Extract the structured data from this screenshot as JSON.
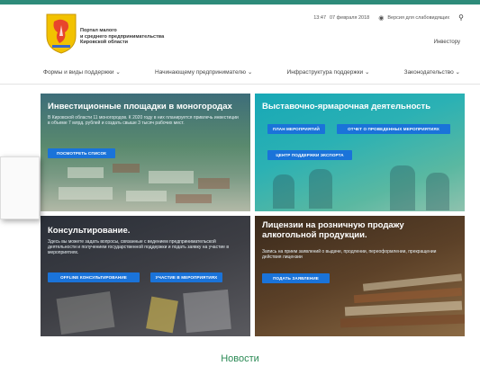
{
  "utility": {
    "time": "13:47",
    "date": "07 февраля 2018",
    "accessibility_label": "Версия для слабовидящих"
  },
  "org": {
    "name_line1": "Портал малого",
    "name_line2": "и среднего предпринимательства",
    "name_line3": "Кировской области"
  },
  "investor_link": "Инвестору",
  "nav": {
    "items": [
      {
        "label": "Формы и виды поддержки ⌄"
      },
      {
        "label": "Начинающему предпринимателю ⌄"
      },
      {
        "label": "Инфраструктура поддержки ⌄"
      },
      {
        "label": "Законодательство ⌄"
      }
    ]
  },
  "tiles": [
    {
      "title": "Инвестиционные площадки в моногородах",
      "desc": "В Кировской области 11 моногородов. К 2020 году в них планируется привлечь инвестиции в объеме 7 млрд. рублей и создать свыше 3 тысяч рабочих мест.",
      "buttons": [
        "ПОСМОТРЕТЬ СПИСОК"
      ]
    },
    {
      "title": "Выставочно-ярмарочная деятельность",
      "desc": "",
      "buttons": [
        "ПЛАН МЕРОПРИЯТИЙ",
        "ОТЧЕТ О ПРОВЕДЕННЫХ МЕРОПРИЯТИЯХ",
        "ЦЕНТР ПОДДЕРЖКИ ЭКСПОРТА"
      ]
    },
    {
      "title": "Консультирование.",
      "desc": "Здесь вы можете задать вопросы, связанные с ведением предпринимательской деятельности и получением государственной поддержки и подать заявку на участие в мероприятиях.",
      "buttons": [
        "OFFLINE КОНСУЛЬТИРОВАНИЕ",
        "УЧАСТИЕ В МЕРОПРИЯТИЯХ"
      ]
    },
    {
      "title": "Лицензии на розничную продажу алкогольной продукции.",
      "desc": "Запись на прием заявлений о выдаче, продлении, переоформлении, прекращении действия лицензии",
      "buttons": [
        "ПОДАТЬ ЗАЯВЛЕНИЕ"
      ]
    }
  ],
  "news_heading": "Новости",
  "colors": {
    "accent_green": "#2b8a55",
    "button_blue": "#1a73d9",
    "top_bar": "#2e8b7a"
  }
}
